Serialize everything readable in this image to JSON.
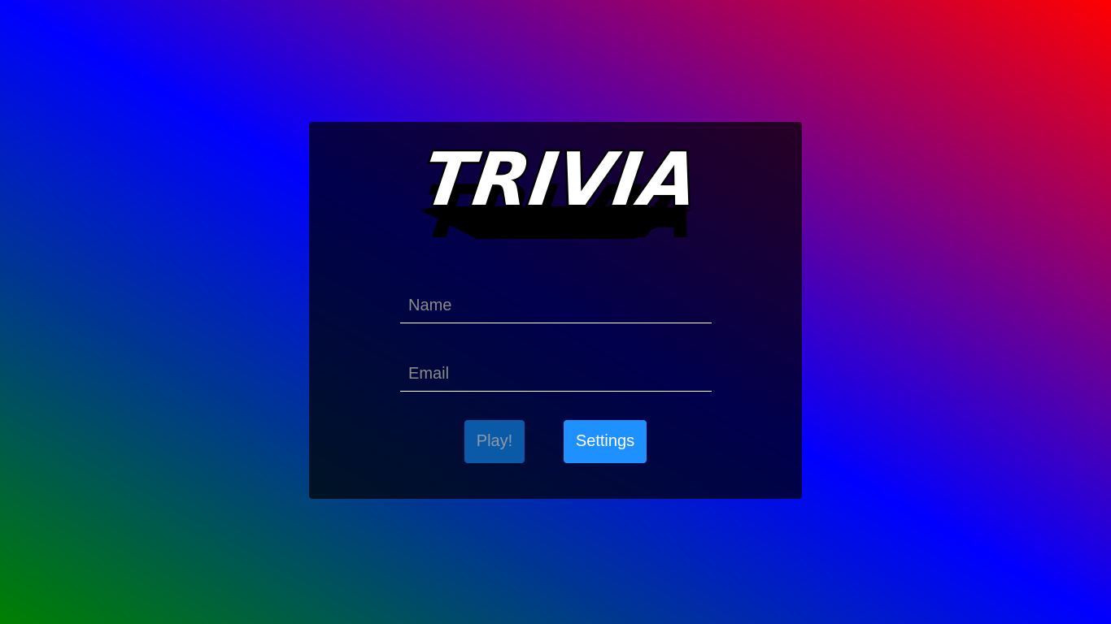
{
  "app": {
    "logo_text": "TRIVIA"
  },
  "form": {
    "name": {
      "placeholder": "Name",
      "value": ""
    },
    "email": {
      "placeholder": "Email",
      "value": ""
    }
  },
  "buttons": {
    "play_label": "Play!",
    "play_disabled": true,
    "settings_label": "Settings"
  },
  "colors": {
    "background_gradient": [
      "#008000",
      "#0000ff",
      "#ff0000"
    ],
    "settings_button": "#1e90ff",
    "play_button_disabled": "#0a5aa8"
  }
}
